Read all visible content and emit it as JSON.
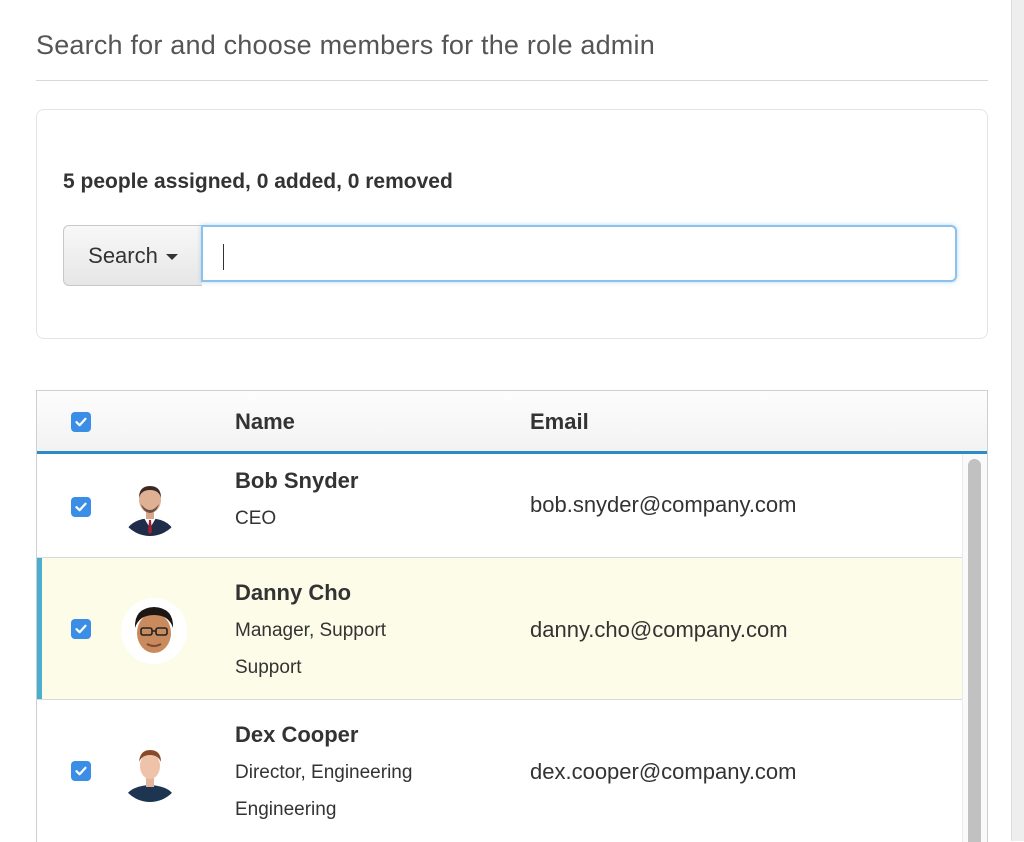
{
  "modal": {
    "title": "Search for and choose members for the role admin"
  },
  "search_panel": {
    "summary": "5 people assigned, 0 added, 0 removed",
    "search_button_label": "Search",
    "search_value": ""
  },
  "table": {
    "headers": {
      "name": "Name",
      "email": "Email"
    },
    "rows": [
      {
        "name": "Bob Snyder",
        "title": "CEO",
        "department": "",
        "email": "bob.snyder@company.com",
        "checked": true
      },
      {
        "name": "Danny Cho",
        "title": "Manager, Support",
        "department": "Support",
        "email": "danny.cho@company.com",
        "checked": true
      },
      {
        "name": "Dex Cooper",
        "title": "Director, Engineering",
        "department": "Engineering",
        "email": "dex.cooper@company.com",
        "checked": true
      }
    ]
  },
  "colors": {
    "accent_blue": "#2d8bc5",
    "checkbox_blue": "#3a8ee6",
    "highlight_row": "#fcfce9",
    "highlight_bar": "#4aaecf"
  },
  "icons": {
    "checkbox": "check-icon",
    "dropdown": "caret-down-icon"
  }
}
